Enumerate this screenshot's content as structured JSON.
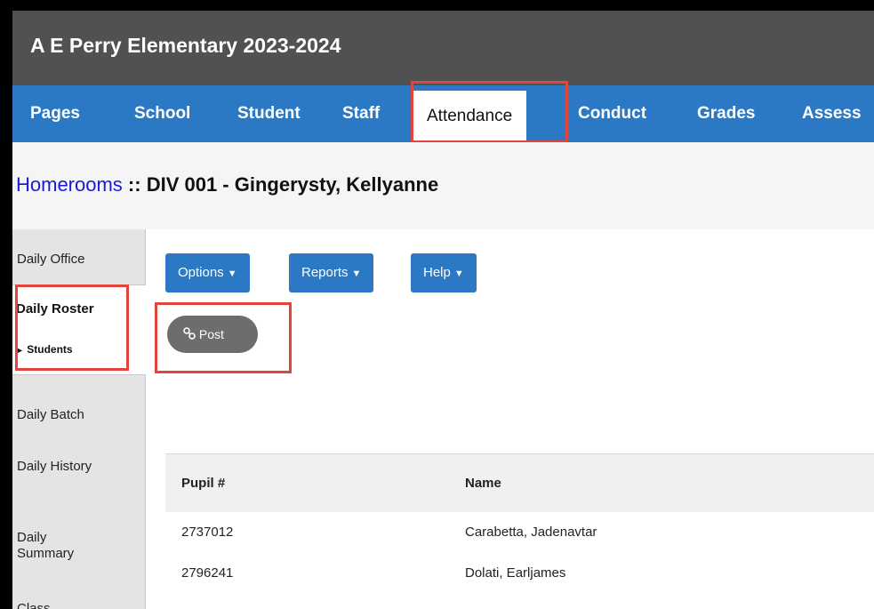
{
  "app": {
    "title": "A E Perry Elementary 2023-2024"
  },
  "nav": {
    "items": [
      "Pages",
      "School",
      "Student",
      "Staff",
      "Attendance",
      "Conduct",
      "Grades",
      "Assess"
    ],
    "active": "Attendance"
  },
  "breadcrumb": {
    "link": "Homerooms",
    "separator": " :: ",
    "text": "DIV 001 - Gingerysty, Kellyanne"
  },
  "sidebar": {
    "items": [
      "Daily Office",
      "Daily Roster",
      "Daily Batch",
      "Daily History",
      "Daily Summary",
      "Class"
    ],
    "active_index": 1,
    "active_sub": "Students",
    "active_sub_icon": "triangle-right-icon"
  },
  "toolbar": {
    "options_label": "Options",
    "reports_label": "Reports",
    "help_label": "Help",
    "post_label": "Post",
    "post_icon": "link-icon"
  },
  "table": {
    "columns": [
      "Pupil #",
      "Name"
    ],
    "rows": [
      [
        "2737012",
        "Carabetta, Jadenavtar"
      ],
      [
        "2796241",
        "Dolati, Earljames"
      ]
    ]
  },
  "colors": {
    "title_bar": "#515151",
    "nav_bar": "#2b78c4",
    "highlight_box": "#e0463b",
    "post_button": "#6d6d6d"
  }
}
